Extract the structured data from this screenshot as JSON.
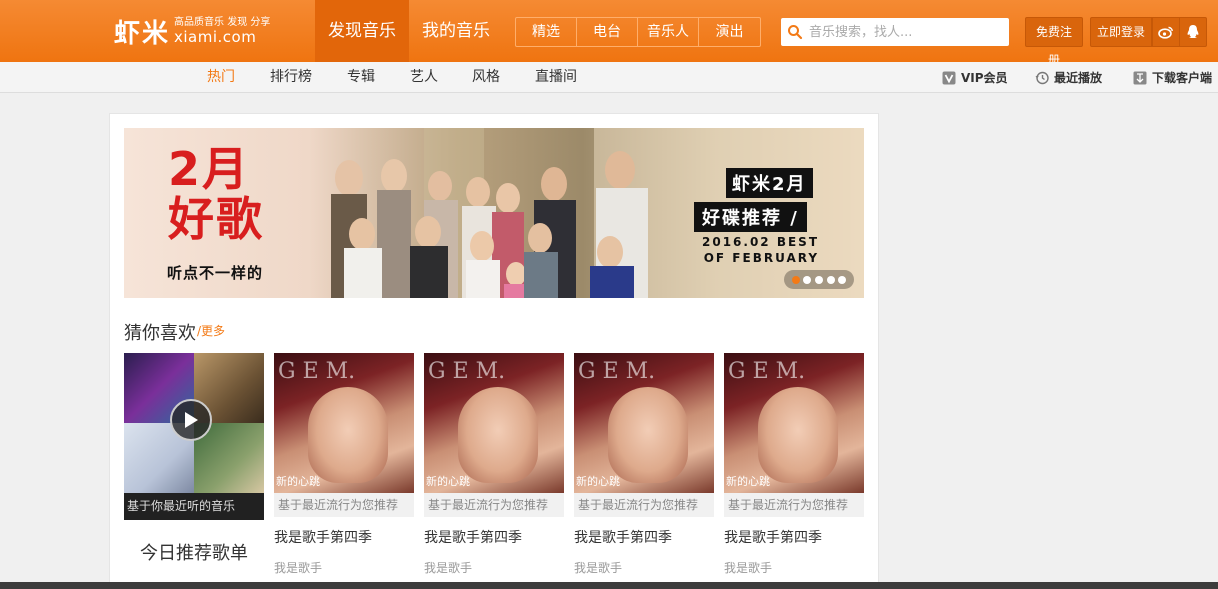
{
  "header": {
    "logo": {
      "main": "虾米",
      "slogan": "高品质音乐 发现 分享",
      "domain": "xiami.com"
    },
    "main_nav": [
      {
        "label": "发现音乐",
        "active": true
      },
      {
        "label": "我的音乐",
        "active": false
      }
    ],
    "sub_nav": [
      "精选",
      "电台",
      "音乐人",
      "演出"
    ],
    "search": {
      "placeholder": "音乐搜索，找人...",
      "value": ""
    },
    "register_label": "免费注册",
    "login_label": "立即登录",
    "social_icons": [
      "weibo-icon",
      "qq-icon"
    ]
  },
  "secondary_nav": {
    "categories": [
      {
        "label": "热门",
        "active": true
      },
      {
        "label": "排行榜",
        "active": false
      },
      {
        "label": "专辑",
        "active": false
      },
      {
        "label": "艺人",
        "active": false
      },
      {
        "label": "风格",
        "active": false
      },
      {
        "label": "直播间",
        "active": false
      }
    ],
    "utilities": [
      {
        "label": "VIP会员",
        "icon": "vip-icon"
      },
      {
        "label": "最近播放",
        "icon": "history-icon"
      },
      {
        "label": "下载客户端",
        "icon": "download-icon"
      }
    ]
  },
  "banner": {
    "title_line1": "2月",
    "title_line2": "好歌",
    "subtitle": "听点不一样的",
    "tag1": "虾米2月",
    "tag2": "好碟推荐 /",
    "english_line1": "2016.02 BEST",
    "english_line2": "OF FEBRUARY",
    "slide_count": 5,
    "active_slide": 1
  },
  "recommend": {
    "title": "猜你喜欢",
    "more": "/更多",
    "featured": {
      "caption": "基于你最近听的音乐",
      "name": "今日推荐歌单"
    },
    "items": [
      {
        "cover_text": "G E M.",
        "cover_logo": "新的心跳",
        "caption": "基于最近流行为您推荐",
        "name": "我是歌手第四季",
        "artist": "我是歌手"
      },
      {
        "cover_text": "G E M.",
        "cover_logo": "新的心跳",
        "caption": "基于最近流行为您推荐",
        "name": "我是歌手第四季",
        "artist": "我是歌手"
      },
      {
        "cover_text": "G E M.",
        "cover_logo": "新的心跳",
        "caption": "基于最近流行为您推荐",
        "name": "我是歌手第四季",
        "artist": "我是歌手"
      },
      {
        "cover_text": "G E M.",
        "cover_logo": "新的心跳",
        "caption": "基于最近流行为您推荐",
        "name": "我是歌手第四季",
        "artist": "我是歌手"
      }
    ]
  },
  "colors": {
    "brand_orange": "#f37a16",
    "header_bg": "#ef7410"
  }
}
